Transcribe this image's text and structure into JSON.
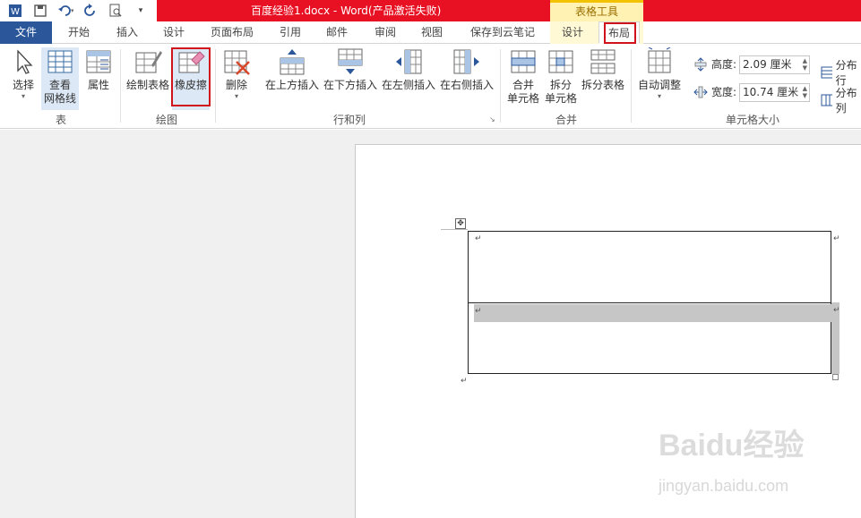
{
  "title_bar": {
    "document_title": "百度经验1.docx - Word(产品激活失败)",
    "context_tab_group": "表格工具",
    "quick_access_icons": [
      "word-icon",
      "save-icon",
      "undo-icon",
      "redo-icon",
      "print-preview-icon",
      "more-icon"
    ]
  },
  "tabs": {
    "file": "文件",
    "items": [
      "开始",
      "插入",
      "设计",
      "页面布局",
      "引用",
      "邮件",
      "审阅",
      "视图",
      "保存到云笔记",
      "设计",
      "布局"
    ],
    "active": "布局"
  },
  "ribbon": {
    "groups": {
      "table": "表",
      "draw": "绘图",
      "rows_cols": "行和列",
      "merge": "合并",
      "cell_size": "单元格大小"
    },
    "buttons": {
      "select": "选择",
      "view_gridlines_1": "查看",
      "view_gridlines_2": "网格线",
      "properties": "属性",
      "draw_table": "绘制表格",
      "eraser": "橡皮擦",
      "delete": "删除",
      "insert_above": "在上方插入",
      "insert_below": "在下方插入",
      "insert_left": "在左侧插入",
      "insert_right": "在右侧插入",
      "merge_cells_1": "合并",
      "merge_cells_2": "单元格",
      "split_cells_1": "拆分",
      "split_cells_2": "单元格",
      "split_table": "拆分表格",
      "autofit": "自动调整",
      "distribute_rows": "分布行",
      "distribute_cols": "分布列"
    },
    "cell_size": {
      "height_label": "高度:",
      "height_value": "2.09 厘米",
      "width_label": "宽度:",
      "width_value": "10.74 厘米"
    }
  },
  "watermark": {
    "logo": "Baidu经验",
    "url": "jingyan.baidu.com"
  },
  "colors": {
    "file_tab": "#2b579a",
    "title_bar": "#e81123",
    "highlight_box": "#d0121b"
  }
}
